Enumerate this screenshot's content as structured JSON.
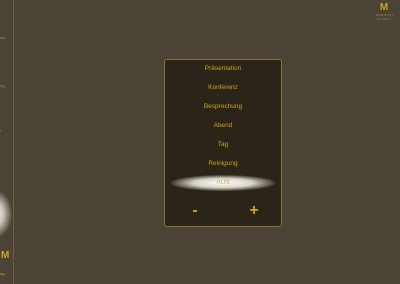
{
  "sidebar": {
    "labels": [
      "tze",
      "ng",
      "i",
      "",
      "",
      "",
      ""
    ],
    "bottom_label": "ng"
  },
  "brand": {
    "mark": "M",
    "word": "MARRIOTT HOTELS"
  },
  "scene_menu": {
    "items": [
      "Präsentation",
      "Konferenz",
      "Besprechung",
      "Abend",
      "Tag",
      "Reinigung",
      "AUS"
    ],
    "selected_index": 6
  },
  "controls": {
    "minus_label": "-",
    "plus_label": "+"
  },
  "colors": {
    "accent": "#d4a01e",
    "background": "#4a4336",
    "panel": "#2a2419"
  }
}
